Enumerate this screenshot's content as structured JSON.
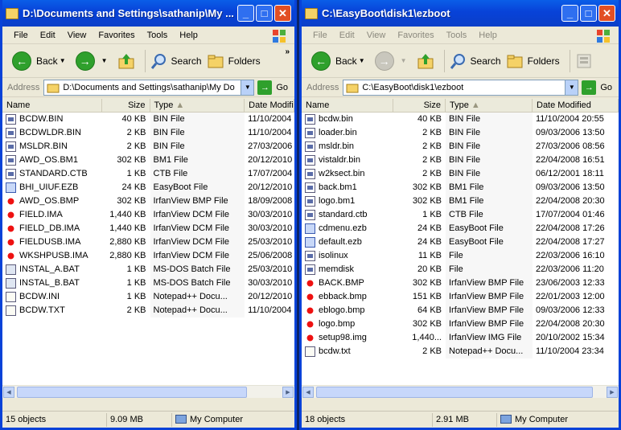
{
  "left": {
    "title": "D:\\Documents and Settings\\sathanip\\My ...",
    "menu": [
      "File",
      "Edit",
      "View",
      "Favorites",
      "Tools",
      "Help"
    ],
    "toolbar": {
      "back": "Back",
      "search": "Search",
      "folders": "Folders"
    },
    "address_label": "Address",
    "address": "D:\\Documents and Settings\\sathanip\\My Do",
    "go": "Go",
    "columns": {
      "name": "Name",
      "size": "Size",
      "type": "Type",
      "date": "Date Modifie"
    },
    "files": [
      {
        "name": "BCDW.BIN",
        "size": "40 KB",
        "type": "BIN File",
        "date": "11/10/2004",
        "icon": "bin"
      },
      {
        "name": "BCDWLDR.BIN",
        "size": "2 KB",
        "type": "BIN File",
        "date": "11/10/2004",
        "icon": "bin"
      },
      {
        "name": "MSLDR.BIN",
        "size": "2 KB",
        "type": "BIN File",
        "date": "27/03/2006",
        "icon": "bin"
      },
      {
        "name": "AWD_OS.BM1",
        "size": "302 KB",
        "type": "BM1 File",
        "date": "20/12/2010",
        "icon": "bin"
      },
      {
        "name": "STANDARD.CTB",
        "size": "1 KB",
        "type": "CTB File",
        "date": "17/07/2004",
        "icon": "bin"
      },
      {
        "name": "BHI_UIUF.EZB",
        "size": "24 KB",
        "type": "EasyBoot File",
        "date": "20/12/2010",
        "icon": "ezb"
      },
      {
        "name": "AWD_OS.BMP",
        "size": "302 KB",
        "type": "IrfanView BMP File",
        "date": "18/09/2008",
        "icon": "bmp"
      },
      {
        "name": "FIELD.IMA",
        "size": "1,440 KB",
        "type": "IrfanView DCM File",
        "date": "30/03/2010",
        "icon": "bmp"
      },
      {
        "name": "FIELD_DB.IMA",
        "size": "1,440 KB",
        "type": "IrfanView DCM File",
        "date": "30/03/2010",
        "icon": "bmp"
      },
      {
        "name": "FIELDUSB.IMA",
        "size": "2,880 KB",
        "type": "IrfanView DCM File",
        "date": "25/03/2010",
        "icon": "bmp"
      },
      {
        "name": "WKSHPUSB.IMA",
        "size": "2,880 KB",
        "type": "IrfanView DCM File",
        "date": "25/06/2008",
        "icon": "bmp"
      },
      {
        "name": "INSTAL_A.BAT",
        "size": "1 KB",
        "type": "MS-DOS Batch File",
        "date": "25/03/2010",
        "icon": "bat"
      },
      {
        "name": "INSTAL_B.BAT",
        "size": "1 KB",
        "type": "MS-DOS Batch File",
        "date": "30/03/2010",
        "icon": "bat"
      },
      {
        "name": "BCDW.INI",
        "size": "1 KB",
        "type": "Notepad++ Docu...",
        "date": "20/12/2010",
        "icon": "txt"
      },
      {
        "name": "BCDW.TXT",
        "size": "2 KB",
        "type": "Notepad++ Docu...",
        "date": "11/10/2004",
        "icon": "txt"
      }
    ],
    "status": {
      "objects": "15 objects",
      "size": "9.09 MB",
      "location": "My Computer"
    }
  },
  "right": {
    "title": "C:\\EasyBoot\\disk1\\ezboot",
    "menu": [
      "File",
      "Edit",
      "View",
      "Favorites",
      "Tools",
      "Help"
    ],
    "toolbar": {
      "back": "Back",
      "search": "Search",
      "folders": "Folders"
    },
    "address_label": "Address",
    "address": "C:\\EasyBoot\\disk1\\ezboot",
    "go": "Go",
    "columns": {
      "name": "Name",
      "size": "Size",
      "type": "Type",
      "date": "Date Modified"
    },
    "files": [
      {
        "name": "bcdw.bin",
        "size": "40 KB",
        "type": "BIN File",
        "date": "11/10/2004 20:55",
        "icon": "bin"
      },
      {
        "name": "loader.bin",
        "size": "2 KB",
        "type": "BIN File",
        "date": "09/03/2006 13:50",
        "icon": "bin"
      },
      {
        "name": "msldr.bin",
        "size": "2 KB",
        "type": "BIN File",
        "date": "27/03/2006 08:56",
        "icon": "bin"
      },
      {
        "name": "vistaldr.bin",
        "size": "2 KB",
        "type": "BIN File",
        "date": "22/04/2008 16:51",
        "icon": "bin"
      },
      {
        "name": "w2ksect.bin",
        "size": "2 KB",
        "type": "BIN File",
        "date": "06/12/2001 18:11",
        "icon": "bin"
      },
      {
        "name": "back.bm1",
        "size": "302 KB",
        "type": "BM1 File",
        "date": "09/03/2006 13:50",
        "icon": "bin"
      },
      {
        "name": "logo.bm1",
        "size": "302 KB",
        "type": "BM1 File",
        "date": "22/04/2008 20:30",
        "icon": "bin"
      },
      {
        "name": "standard.ctb",
        "size": "1 KB",
        "type": "CTB File",
        "date": "17/07/2004 01:46",
        "icon": "bin"
      },
      {
        "name": "cdmenu.ezb",
        "size": "24 KB",
        "type": "EasyBoot File",
        "date": "22/04/2008 17:26",
        "icon": "ezb"
      },
      {
        "name": "default.ezb",
        "size": "24 KB",
        "type": "EasyBoot File",
        "date": "22/04/2008 17:27",
        "icon": "ezb"
      },
      {
        "name": "isolinux",
        "size": "11 KB",
        "type": "File",
        "date": "22/03/2006 16:10",
        "icon": "bin"
      },
      {
        "name": "memdisk",
        "size": "20 KB",
        "type": "File",
        "date": "22/03/2006 11:20",
        "icon": "bin"
      },
      {
        "name": "BACK.BMP",
        "size": "302 KB",
        "type": "IrfanView BMP File",
        "date": "23/06/2003 12:33",
        "icon": "bmp"
      },
      {
        "name": "ebback.bmp",
        "size": "151 KB",
        "type": "IrfanView BMP File",
        "date": "22/01/2003 12:00",
        "icon": "bmp"
      },
      {
        "name": "eblogo.bmp",
        "size": "64 KB",
        "type": "IrfanView BMP File",
        "date": "09/03/2006 12:33",
        "icon": "bmp"
      },
      {
        "name": "logo.bmp",
        "size": "302 KB",
        "type": "IrfanView BMP File",
        "date": "22/04/2008 20:30",
        "icon": "bmp"
      },
      {
        "name": "setup98.img",
        "size": "1,440...",
        "type": "IrfanView IMG File",
        "date": "20/10/2002 15:34",
        "icon": "bmp"
      },
      {
        "name": "bcdw.txt",
        "size": "2 KB",
        "type": "Notepad++ Docu...",
        "date": "11/10/2004 23:34",
        "icon": "txt"
      }
    ],
    "status": {
      "objects": "18 objects",
      "size": "2.91 MB",
      "location": "My Computer"
    }
  }
}
